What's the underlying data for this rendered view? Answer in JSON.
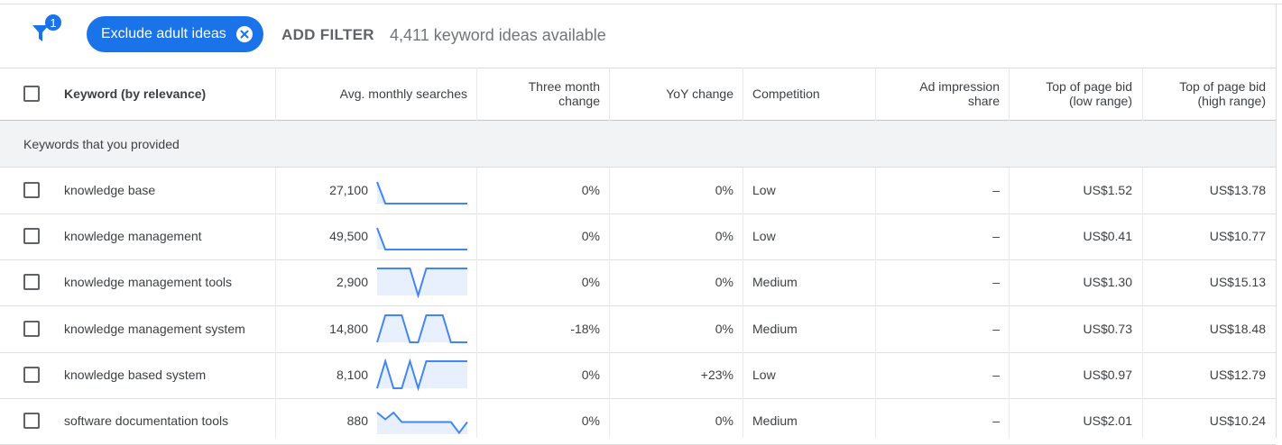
{
  "filter_bar": {
    "filter_count": "1",
    "chip_label": "Exclude adult ideas",
    "add_filter_label": "ADD FILTER",
    "idea_count": "4,411 keyword ideas available"
  },
  "columns": {
    "keyword": "Keyword (by relevance)",
    "avg_monthly": "Avg. monthly searches",
    "three_month_1": "Three month",
    "three_month_2": "change",
    "yoy": "YoY change",
    "competition": "Competition",
    "impression_1": "Ad impression",
    "impression_2": "share",
    "bid_low_1": "Top of page bid",
    "bid_low_2": "(low range)",
    "bid_high_1": "Top of page bid",
    "bid_high_2": "(high range)"
  },
  "group_label": "Keywords that you provided",
  "colors": {
    "accent": "#1a73e8",
    "spark_line": "#4285f4",
    "spark_fill": "#e8f0fe"
  },
  "rows": [
    {
      "keyword": "knowledge base",
      "searches": "27,100",
      "three_month": "0%",
      "yoy": "0%",
      "competition": "Low",
      "impression": "–",
      "bid_low": "US$1.52",
      "bid_high": "US$13.78",
      "trend": [
        0.2,
        1,
        1,
        1,
        1,
        1,
        1,
        1,
        1,
        1,
        1,
        1
      ]
    },
    {
      "keyword": "knowledge management",
      "searches": "49,500",
      "three_month": "0%",
      "yoy": "0%",
      "competition": "Low",
      "impression": "–",
      "bid_low": "US$0.41",
      "bid_high": "US$10.77",
      "trend": [
        0.2,
        1,
        1,
        1,
        1,
        1,
        1,
        1,
        1,
        1,
        1,
        1
      ]
    },
    {
      "keyword": "knowledge management tools",
      "searches": "2,900",
      "three_month": "0%",
      "yoy": "0%",
      "competition": "Medium",
      "impression": "–",
      "bid_low": "US$1.30",
      "bid_high": "US$15.13",
      "trend": [
        0,
        0,
        0,
        0,
        0,
        1,
        0,
        0,
        0,
        0,
        0,
        0
      ]
    },
    {
      "keyword": "knowledge management system",
      "searches": "14,800",
      "three_month": "-18%",
      "yoy": "0%",
      "competition": "Medium",
      "impression": "–",
      "bid_low": "US$0.73",
      "bid_high": "US$18.48",
      "trend": [
        1,
        0,
        0,
        0,
        1,
        1,
        0,
        0,
        0,
        1,
        1,
        1
      ]
    },
    {
      "keyword": "knowledge based system",
      "searches": "8,100",
      "three_month": "0%",
      "yoy": "+23%",
      "competition": "Low",
      "impression": "–",
      "bid_low": "US$0.97",
      "bid_high": "US$12.79",
      "trend": [
        1,
        0,
        1,
        1,
        0,
        1,
        0,
        0,
        0,
        0,
        0,
        0
      ]
    },
    {
      "keyword": "software documentation tools",
      "searches": "880",
      "three_month": "0%",
      "yoy": "0%",
      "competition": "Medium",
      "impression": "–",
      "bid_low": "US$2.01",
      "bid_high": "US$10.24",
      "trend": [
        0.2,
        0.45,
        0.2,
        0.55,
        0.55,
        0.55,
        0.55,
        0.55,
        0.55,
        0.55,
        0.95,
        0.55
      ]
    }
  ]
}
